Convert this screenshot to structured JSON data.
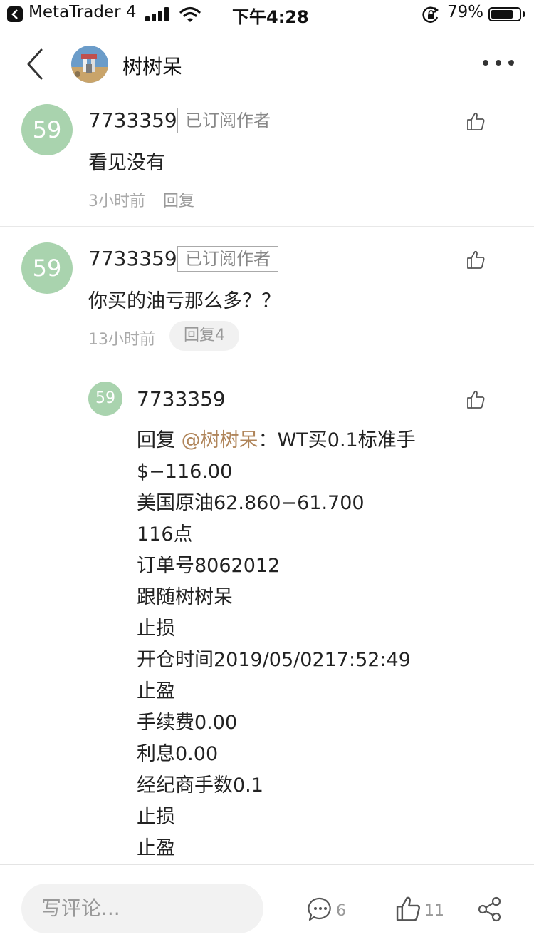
{
  "status_bar": {
    "app_name": "MetaTrader 4",
    "time": "下午4:28",
    "battery_percent": "79%",
    "battery_level": 0.79
  },
  "nav": {
    "title": "树树呆"
  },
  "comments": [
    {
      "avatar_text": "59",
      "username": "7733359",
      "badge": "已订阅作者",
      "text": "看见没有",
      "time": "3小时前",
      "reply_label": "回复"
    },
    {
      "avatar_text": "59",
      "username": "7733359",
      "badge": "已订阅作者",
      "text": "你买的油亏那么多？？",
      "time": "13小时前",
      "reply_label": "回复4"
    }
  ],
  "reply": {
    "avatar_text": "59",
    "username": "7733359",
    "prefix": "回复 ",
    "mention": "@树树呆",
    "first_line_rest": "：WT买0.1标准手",
    "lines": [
      "$−116.00",
      "美国原油62.860−61.700",
      "116点",
      "订单号8062012",
      "跟随树树呆",
      "止损",
      "开仓时间2019/05/0217:52:49",
      "止盈",
      "手续费0.00",
      "利息0.00",
      "经纪商手数0.1",
      "止损",
      "止盈"
    ]
  },
  "bottom_bar": {
    "input_placeholder": "写评论...",
    "comment_count": "6",
    "like_count": "11"
  },
  "colors": {
    "avatar_green": "#a9d3ae",
    "mention": "#b0855a",
    "muted_text": "#aaaaaa"
  }
}
